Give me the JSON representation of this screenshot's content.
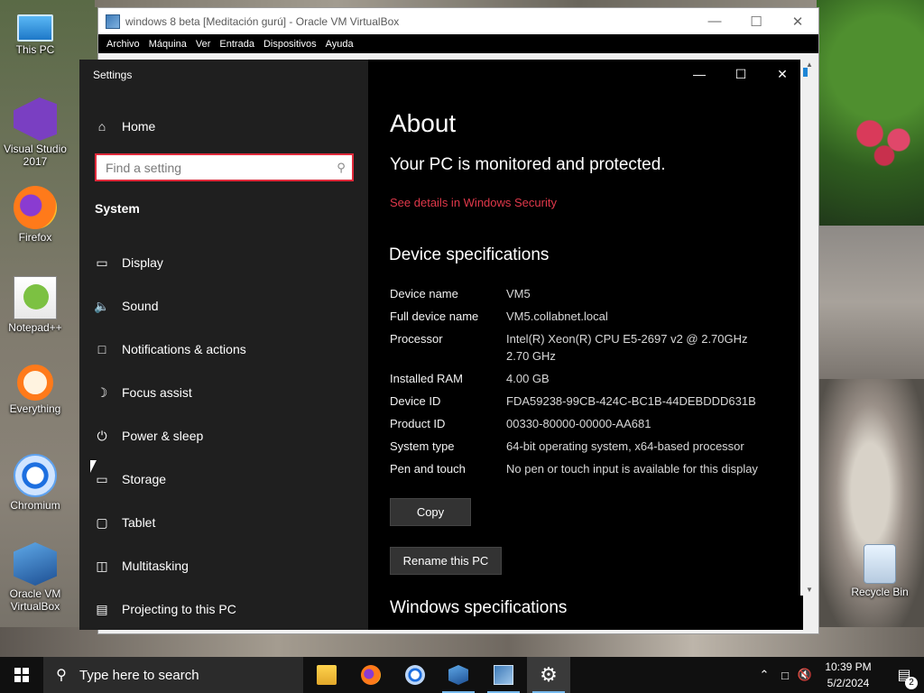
{
  "desktop": {
    "icons": [
      {
        "label": "This PC",
        "icon": "computer-icon"
      },
      {
        "label": "Visual Studio 2017",
        "icon": "visual-studio-icon"
      },
      {
        "label": "Firefox",
        "icon": "firefox-icon"
      },
      {
        "label": "Notepad++",
        "icon": "notepad-plus-plus-icon"
      },
      {
        "label": "Everything",
        "icon": "everything-search-icon"
      },
      {
        "label": "Chromium",
        "icon": "chromium-icon"
      },
      {
        "label": "Oracle VM VirtualBox",
        "icon": "virtualbox-icon"
      },
      {
        "label": "Recycle Bin",
        "icon": "recycle-bin-icon"
      }
    ]
  },
  "vbox": {
    "title": "windows 8 beta [Meditación gurú] - Oracle VM VirtualBox",
    "menu": [
      "Archivo",
      "Máquina",
      "Ver",
      "Entrada",
      "Dispositivos",
      "Ayuda"
    ]
  },
  "settings": {
    "app_title": "Settings",
    "home_label": "Home",
    "search_placeholder": "Find a setting",
    "section_label": "System",
    "nav_items": [
      {
        "label": "Display",
        "icon": "display-icon"
      },
      {
        "label": "Sound",
        "icon": "speaker-icon"
      },
      {
        "label": "Notifications & actions",
        "icon": "notification-icon"
      },
      {
        "label": "Focus assist",
        "icon": "moon-icon"
      },
      {
        "label": "Power & sleep",
        "icon": "power-icon"
      },
      {
        "label": "Storage",
        "icon": "storage-icon"
      },
      {
        "label": "Tablet",
        "icon": "tablet-icon"
      },
      {
        "label": "Multitasking",
        "icon": "multitasking-icon"
      },
      {
        "label": "Projecting to this PC",
        "icon": "projector-icon"
      }
    ]
  },
  "about": {
    "title": "About",
    "protected_text": "Your PC is monitored and protected.",
    "security_link": "See details in Windows Security",
    "device_heading": "Device specifications",
    "specs": [
      {
        "key": "Device name",
        "value": "VM5"
      },
      {
        "key": "Full device name",
        "value": "VM5.collabnet.local"
      },
      {
        "key": "Processor",
        "value": "Intel(R) Xeon(R) CPU E5-2697 v2 @ 2.70GHz 2.70 GHz"
      },
      {
        "key": "Installed RAM",
        "value": "4.00 GB"
      },
      {
        "key": "Device ID",
        "value": "FDA59238-99CB-424C-BC1B-44DEBDDD631B"
      },
      {
        "key": "Product ID",
        "value": "00330-80000-00000-AA681"
      },
      {
        "key": "System type",
        "value": "64-bit operating system, x64-based processor"
      },
      {
        "key": "Pen and touch",
        "value": "No pen or touch input is available for this display"
      }
    ],
    "copy_label": "Copy",
    "rename_label": "Rename this PC",
    "windows_heading": "Windows specifications"
  },
  "taskbar": {
    "search_placeholder": "Type here to search",
    "apps": [
      "file-explorer-icon",
      "firefox-icon",
      "chromium-icon",
      "virtualbox-icon",
      "vm-window-icon",
      "gear-icon"
    ],
    "clock_time": "10:39 PM",
    "clock_date": "5/2/2024",
    "notification_count": "2"
  },
  "colors": {
    "accent_red": "#e02a3b",
    "link_red": "#e0384a",
    "nav_bg": "#1f1f1f",
    "main_bg": "#000000",
    "taskbar_bg": "#101010"
  }
}
